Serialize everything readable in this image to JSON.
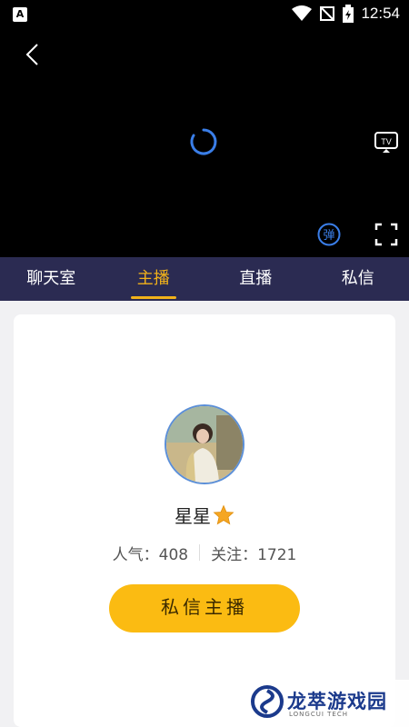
{
  "status_bar": {
    "app_icon": "A",
    "time": "12:54"
  },
  "tabs": [
    {
      "label": "聊天室",
      "active": false
    },
    {
      "label": "主播",
      "active": true
    },
    {
      "label": "直播",
      "active": false
    },
    {
      "label": "私信",
      "active": false
    }
  ],
  "player": {
    "danmu_label": "弹",
    "tv_label": "TV"
  },
  "anchor": {
    "name": "星星",
    "popularity": "人气：408",
    "follows": "关注：1721",
    "message_button": "私信主播"
  },
  "watermark": {
    "title": "龙萃游戏园",
    "subtitle": "LONGCUI TECH"
  },
  "colors": {
    "accent": "#f2b21a",
    "tab_bar": "#2b2b52",
    "button": "#fbbb12",
    "spinner": "#3a7ee8"
  }
}
